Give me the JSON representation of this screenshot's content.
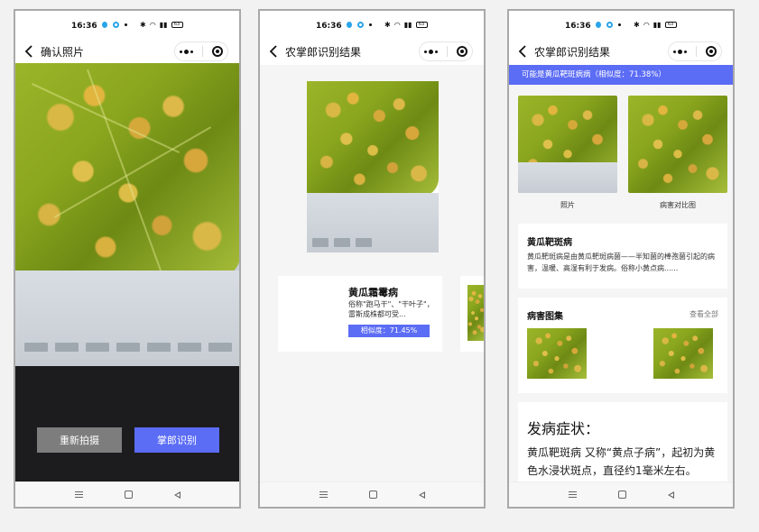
{
  "status_bar": {
    "time": "16:36",
    "battery": "63"
  },
  "screens": [
    {
      "nav_title": "确认照片",
      "retake_label": "重新拍摄",
      "identify_label": "掌郎识别"
    },
    {
      "nav_title": "农掌郎识别结果",
      "result": {
        "name": "黄瓜霜霉病",
        "desc": "俗称\"跑马干\"、\"干叶子\"，雷斯成株都可受...",
        "similarity": "相似度：71.45%"
      }
    },
    {
      "nav_title": "农掌郎识别结果",
      "banner": "可能是黄瓜靶斑病病（相似度：71.38%）",
      "compare_labels": {
        "photo": "照片",
        "reference": "病害对比图"
      },
      "intro": {
        "title": "黄瓜靶斑病",
        "text": "黄瓜靶斑病是由黄瓜靶斑病菌——半知菌的棒孢菌引起的病害，温暖、高湿有利于发病。俗称小黄点病......"
      },
      "gallery": {
        "title": "病害图集",
        "view_all": "查看全部"
      },
      "symptoms": {
        "title": "发病症状：",
        "text": "黄瓜靶斑病 又称“黄点子病”，起初为黄色水浸状斑点，直径约1毫米左右。"
      }
    }
  ],
  "colors": {
    "accent": "#5b6cf5",
    "retake_button": "#7d7d7d",
    "camera_bg": "#1c1c1e"
  }
}
